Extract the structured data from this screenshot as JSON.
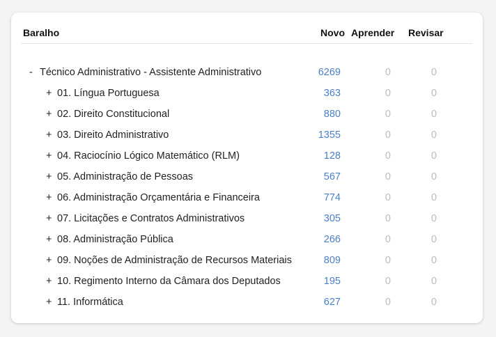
{
  "header": {
    "deck": "Baralho",
    "new": "Novo",
    "learn": "Aprender",
    "review": "Revisar"
  },
  "decks": [
    {
      "toggle": "-",
      "name": "Técnico Administrativo - Assistente Administrativo",
      "new": "6269",
      "learn": "0",
      "review": "0",
      "level": "top"
    },
    {
      "toggle": "+",
      "name": "01. Língua Portuguesa",
      "new": "363",
      "learn": "0",
      "review": "0",
      "level": "child"
    },
    {
      "toggle": "+",
      "name": "02. Direito Constitucional",
      "new": "880",
      "learn": "0",
      "review": "0",
      "level": "child"
    },
    {
      "toggle": "+",
      "name": "03. Direito Administrativo",
      "new": "1355",
      "learn": "0",
      "review": "0",
      "level": "child"
    },
    {
      "toggle": "+",
      "name": "04. Raciocínio Lógico Matemático (RLM)",
      "new": "128",
      "learn": "0",
      "review": "0",
      "level": "child"
    },
    {
      "toggle": "+",
      "name": "05. Administração de Pessoas",
      "new": "567",
      "learn": "0",
      "review": "0",
      "level": "child"
    },
    {
      "toggle": "+",
      "name": "06. Administração Orçamentária e Financeira",
      "new": "774",
      "learn": "0",
      "review": "0",
      "level": "child"
    },
    {
      "toggle": "+",
      "name": "07. Licitações e Contratos Administrativos",
      "new": "305",
      "learn": "0",
      "review": "0",
      "level": "child"
    },
    {
      "toggle": "+",
      "name": "08. Administração Pública",
      "new": "266",
      "learn": "0",
      "review": "0",
      "level": "child"
    },
    {
      "toggle": "+",
      "name": "09. Noções de Administração de Recursos Materiais",
      "new": "809",
      "learn": "0",
      "review": "0",
      "level": "child"
    },
    {
      "toggle": "+",
      "name": "10. Regimento Interno da Câmara dos Deputados",
      "new": "195",
      "learn": "0",
      "review": "0",
      "level": "child"
    },
    {
      "toggle": "+",
      "name": "11. Informática",
      "new": "627",
      "learn": "0",
      "review": "0",
      "level": "child"
    }
  ]
}
